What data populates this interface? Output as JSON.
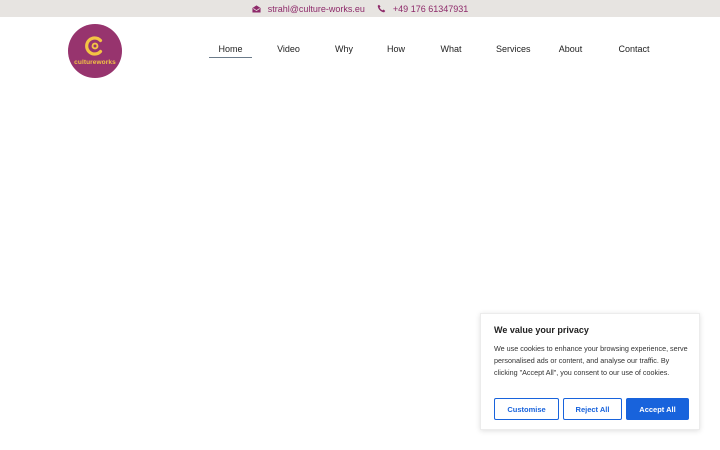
{
  "topbar": {
    "email": "strahl@culture-works.eu",
    "phone": "+49 176 61347931",
    "email_icon": "envelope-open-icon",
    "phone_icon": "phone-icon"
  },
  "logo": {
    "text": "cultureworks",
    "brand_color": "#97346e",
    "accent_color": "#f3c444"
  },
  "nav": {
    "items": [
      {
        "label": "Home",
        "active": true
      },
      {
        "label": "Video",
        "active": false
      },
      {
        "label": "Why",
        "active": false
      },
      {
        "label": "How",
        "active": false
      },
      {
        "label": "What",
        "active": false
      },
      {
        "label": "Services",
        "active": false
      },
      {
        "label": "About",
        "active": false
      },
      {
        "label": "Contact",
        "active": false
      }
    ]
  },
  "cookie": {
    "title": "We value your privacy",
    "body": "We use cookies to enhance your browsing experience, serve personalised ads or content, and analyse our traffic. By clicking \"Accept All\", you consent to our use of cookies.",
    "customise_label": "Customise",
    "reject_label": "Reject All",
    "accept_label": "Accept All",
    "button_color": "#1863dc"
  }
}
